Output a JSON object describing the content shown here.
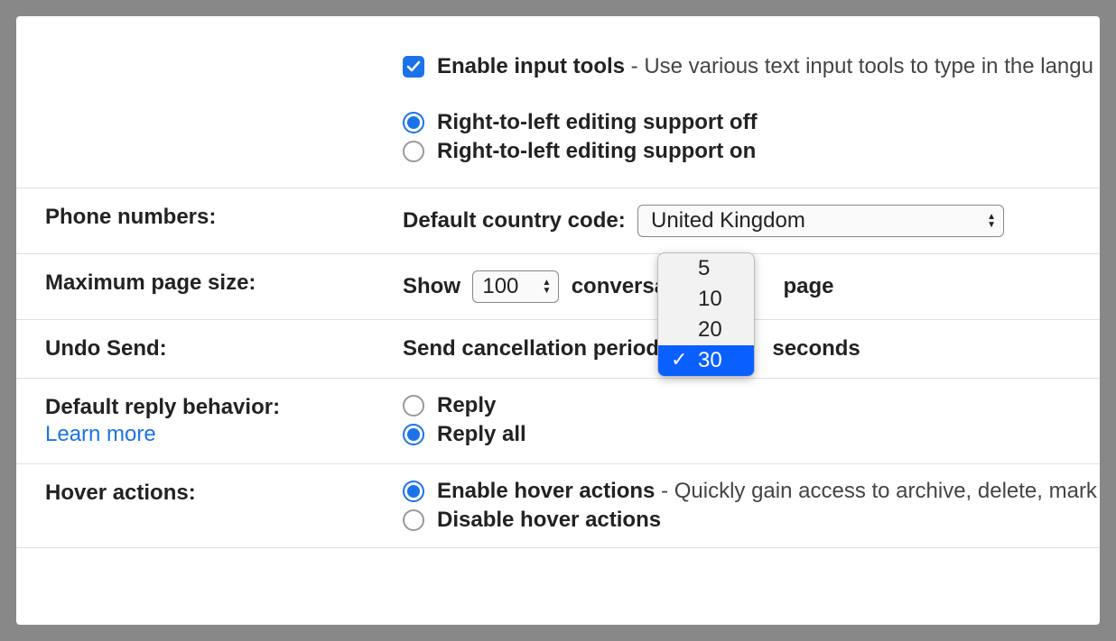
{
  "input_tools": {
    "checkbox_checked": true,
    "label_bold": "Enable input tools",
    "desc": " - Use various text input tools to type in the langu"
  },
  "rtl": {
    "off_label": "Right-to-left editing support off",
    "on_label": "Right-to-left editing support on",
    "selected": "off"
  },
  "phone_numbers": {
    "section_label": "Phone numbers:",
    "prefix": "Default country code:",
    "selected": "United Kingdom"
  },
  "max_page": {
    "section_label": "Maximum page size:",
    "prefix": "Show",
    "selected": "100",
    "suffix_part1": "conversa",
    "suffix_part2": "page"
  },
  "undo_send": {
    "section_label": "Undo Send:",
    "prefix": "Send cancellation period",
    "suffix": "seconds",
    "options": [
      "5",
      "10",
      "20",
      "30"
    ],
    "selected": "30"
  },
  "default_reply": {
    "section_label": "Default reply behavior:",
    "learn_more": "Learn more",
    "reply_label": "Reply",
    "reply_all_label": "Reply all",
    "selected": "reply_all"
  },
  "hover_actions": {
    "section_label": "Hover actions:",
    "enable_bold": "Enable hover actions",
    "enable_desc": " - Quickly gain access to archive, delete, mark",
    "disable_label": "Disable hover actions",
    "selected": "enable"
  }
}
